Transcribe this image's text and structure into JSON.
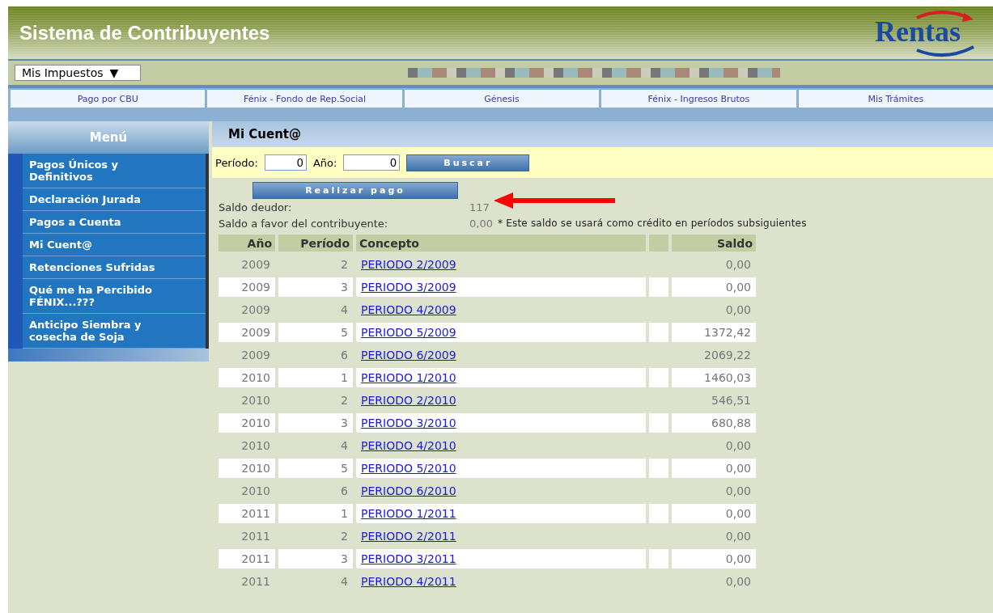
{
  "header": {
    "title": "Sistema de Contribuyentes",
    "logo_text": "Rentas"
  },
  "toolbar": {
    "dropdown": "Mis Impuestos",
    "caret": "▼"
  },
  "tabs": [
    {
      "label": "Pago por CBU"
    },
    {
      "label": "Fénix - Fondo de Rep.Social"
    },
    {
      "label": "Génesis"
    },
    {
      "label": "Fénix - Ingresos Brutos"
    },
    {
      "label": "Mis Trámites"
    }
  ],
  "sidebar": {
    "title": "Menú",
    "items": [
      {
        "label": "Pagos Únicos y Definitivos"
      },
      {
        "label": "Declaración Jurada"
      },
      {
        "label": "Pagos a Cuenta"
      },
      {
        "label": "Mi Cuent@"
      },
      {
        "label": "Retenciones Sufridas"
      },
      {
        "label": "Qué me ha Percibido FÉNIX...???"
      },
      {
        "label": "Anticipo Siembra y cosecha de Soja"
      }
    ]
  },
  "content": {
    "title": "Mi Cuent@",
    "search": {
      "period_label": "Período:",
      "period_value": "0",
      "year_label": "Año:",
      "year_value": "0",
      "button": "Buscar"
    },
    "pay_button": "Realizar pago",
    "debt_label": "Saldo deudor:",
    "debt_value": "117",
    "credit_label": "Saldo a favor del contribuyente:",
    "credit_value": "0,00",
    "credit_note": "* Este saldo se usará como crédito en períodos subsiguientes",
    "table": {
      "columns": [
        "Año",
        "Período",
        "Concepto",
        "",
        "Saldo"
      ],
      "rows": [
        [
          "2009",
          "2",
          "PERIODO 2/2009",
          "0,00"
        ],
        [
          "2009",
          "3",
          "PERIODO 3/2009",
          "0,00"
        ],
        [
          "2009",
          "4",
          "PERIODO 4/2009",
          "0,00"
        ],
        [
          "2009",
          "5",
          "PERIODO 5/2009",
          "1372,42"
        ],
        [
          "2009",
          "6",
          "PERIODO 6/2009",
          "2069,22"
        ],
        [
          "2010",
          "1",
          "PERIODO 1/2010",
          "1460,03"
        ],
        [
          "2010",
          "2",
          "PERIODO 2/2010",
          "546,51"
        ],
        [
          "2010",
          "3",
          "PERIODO 3/2010",
          "680,88"
        ],
        [
          "2010",
          "4",
          "PERIODO 4/2010",
          "0,00"
        ],
        [
          "2010",
          "5",
          "PERIODO 5/2010",
          "0,00"
        ],
        [
          "2010",
          "6",
          "PERIODO 6/2010",
          "0,00"
        ],
        [
          "2011",
          "1",
          "PERIODO 1/2011",
          "0,00"
        ],
        [
          "2011",
          "2",
          "PERIODO 2/2011",
          "0,00"
        ],
        [
          "2011",
          "3",
          "PERIODO 3/2011",
          "0,00"
        ],
        [
          "2011",
          "4",
          "PERIODO 4/2011",
          "0,00"
        ]
      ]
    }
  }
}
